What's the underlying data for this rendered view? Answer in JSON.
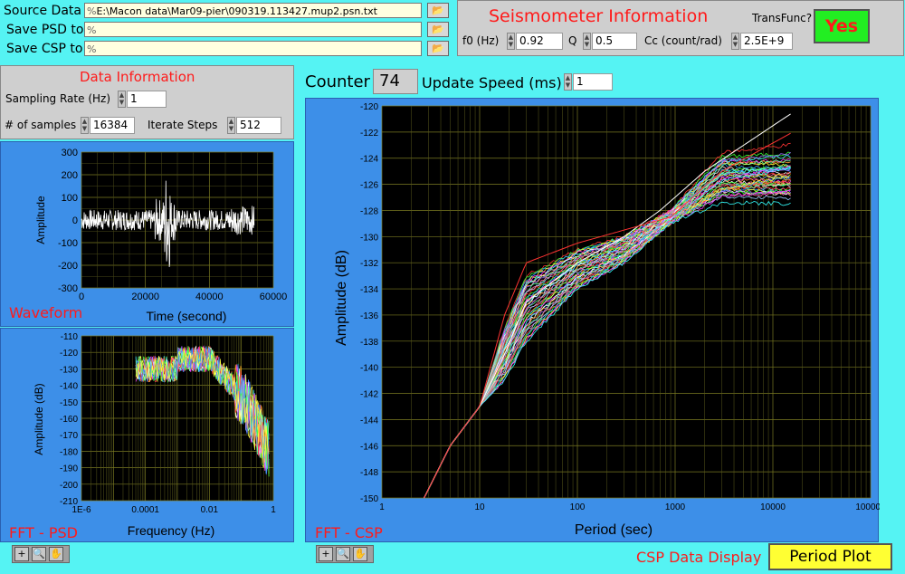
{
  "files": {
    "source_label": "Source Data",
    "source_path": "E:\\Macon data\\Mar09-pier\\090319.113427.mup2.psn.txt",
    "save_psd_label": "Save PSD to",
    "save_psd_path": "",
    "save_csp_label": "Save CSP to",
    "save_csp_path": "",
    "path_prefix": "%"
  },
  "seismometer": {
    "title": "Seismometer Information",
    "transfunc_label": "TransFunc?",
    "transfunc_button": "Yes",
    "f0_label": "f0 (Hz)",
    "f0_value": "0.92",
    "q_label": "Q",
    "q_value": "0.5",
    "cc_label": "Cc (count/rad)",
    "cc_value": "2.5E+9"
  },
  "data_info": {
    "title": "Data Information",
    "sampling_label": "Sampling Rate (Hz)",
    "sampling_value": "1",
    "samples_label": "# of samples",
    "samples_value": "16384",
    "iterate_label": "Iterate Steps",
    "iterate_value": "512"
  },
  "counter": {
    "label": "Counter",
    "value": "74",
    "speed_label": "Update Speed (ms)",
    "speed_value": "1"
  },
  "waveform": {
    "name": "Waveform",
    "xlabel": "Time (second)",
    "ylabel": "Amplitude",
    "xticks": [
      "0",
      "20000",
      "40000",
      "60000"
    ],
    "yticks": [
      "300",
      "200",
      "100",
      "0",
      "-100",
      "-200",
      "-300"
    ]
  },
  "psd": {
    "name": "FFT - PSD",
    "xlabel": "Frequency (Hz)",
    "ylabel": "Amplitude (dB)",
    "xticks": [
      "1E-6",
      "0.0001",
      "0.01",
      "1"
    ],
    "yticks": [
      "-110",
      "-120",
      "-130",
      "-140",
      "-150",
      "-160",
      "-170",
      "-180",
      "-190",
      "-200",
      "-210"
    ]
  },
  "csp": {
    "name": "FFT - CSP",
    "xlabel": "Period (sec)",
    "ylabel": "Amplitude (dB)",
    "xticks": [
      "1",
      "10",
      "100",
      "1000",
      "10000",
      "100000"
    ],
    "yticks": [
      "-120",
      "-122",
      "-124",
      "-126",
      "-128",
      "-130",
      "-132",
      "-134",
      "-136",
      "-138",
      "-140",
      "-142",
      "-144",
      "-146",
      "-148",
      "-150"
    ]
  },
  "footer": {
    "csp_display_label": "CSP Data Display",
    "period_plot_button": "Period Plot"
  },
  "chart_data": [
    {
      "type": "line",
      "title": "Waveform",
      "xlabel": "Time (second)",
      "ylabel": "Amplitude",
      "xlim": [
        0,
        60000
      ],
      "ylim": [
        -300,
        300
      ],
      "grid": true,
      "series": [
        {
          "x": [
            0,
            10000,
            20000,
            25000,
            27000,
            30000,
            40000,
            54000
          ],
          "values": [
            100,
            -50,
            80,
            -150,
            250,
            -120,
            60,
            130
          ]
        }
      ]
    },
    {
      "type": "line",
      "title": "FFT - PSD",
      "xlabel": "Frequency (Hz)",
      "ylabel": "Amplitude (dB)",
      "xscale": "log",
      "xlim": [
        1e-06,
        1
      ],
      "ylim": [
        -210,
        -110
      ],
      "grid": true,
      "series": [
        {
          "x": [
            6e-05,
            0.0003,
            0.001,
            0.01,
            0.1,
            0.5
          ],
          "values": [
            -132,
            -125,
            -122,
            -128,
            -140,
            -185
          ]
        }
      ]
    },
    {
      "type": "line",
      "title": "FFT - CSP",
      "xlabel": "Period (sec)",
      "ylabel": "Amplitude (dB)",
      "xscale": "log",
      "xlim": [
        1,
        100000
      ],
      "ylim": [
        -150,
        -120
      ],
      "grid": true,
      "series": [
        {
          "x": [
            2.7,
            5,
            10,
            18,
            30,
            100,
            300,
            900,
            3000,
            16000
          ],
          "values": [
            -150,
            -146,
            -143,
            -137,
            -133,
            -131,
            -130,
            -128,
            -124,
            -124
          ]
        },
        {
          "x": [
            2.7,
            5,
            10,
            18,
            30,
            100,
            300,
            900,
            3000,
            16000
          ],
          "values": [
            -150,
            -146,
            -143,
            -141,
            -138,
            -134,
            -132,
            -129,
            -127,
            -126.5
          ]
        },
        {
          "x": [
            2.7,
            5,
            10,
            18,
            30,
            100,
            300,
            700,
            2000,
            16000
          ],
          "values": [
            -150,
            -146,
            -143,
            -139,
            -135,
            -132,
            -130,
            -128,
            -125,
            -120.5
          ]
        },
        {
          "x": [
            2.7,
            5,
            10,
            18,
            30,
            100,
            300,
            900,
            3000,
            16000
          ],
          "values": [
            -150,
            -146,
            -143,
            -136,
            -132,
            -130.5,
            -129.5,
            -128.5,
            -125,
            -122
          ]
        }
      ]
    }
  ]
}
